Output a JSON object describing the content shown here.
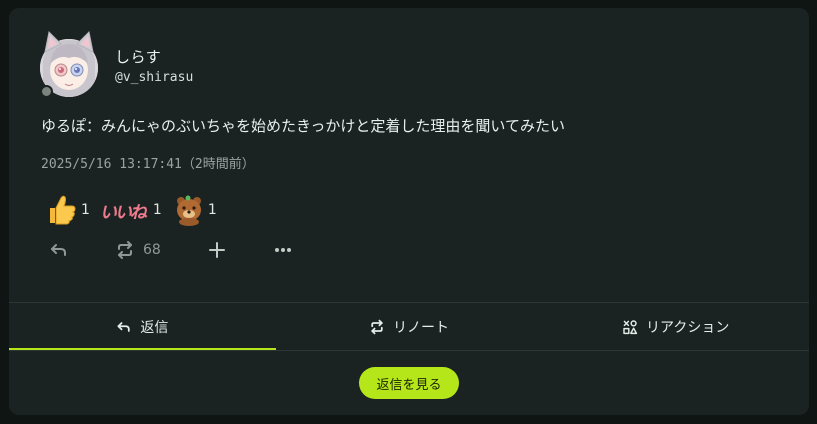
{
  "note": {
    "display_name": "しらす",
    "username": "@v_shirasu",
    "text": "ゆるぽ：みんにゃのぶいちゃを始めたきっかけと定着した理由を聞いてみたい",
    "timestamp": "2025/5/16 13:17:41（2時間前）"
  },
  "reactions": [
    {
      "icon": "thumbs-up-emoji",
      "count": "1"
    },
    {
      "icon": "iine-custom-emoji",
      "label": "いいね",
      "count": "1"
    },
    {
      "icon": "bear-custom-emoji",
      "count": "1"
    }
  ],
  "actions": {
    "reply_icon": "reply-icon",
    "renote_icon": "renote-icon",
    "renote_count": "68",
    "react_icon": "plus-icon",
    "more_icon": "more-icon"
  },
  "tabs": [
    {
      "icon": "reply-icon",
      "label": "返信",
      "active": true
    },
    {
      "icon": "renote-icon",
      "label": "リノート",
      "active": false
    },
    {
      "icon": "reaction-icon",
      "label": "リアクション",
      "active": false
    }
  ],
  "view_replies_label": "返信を見る",
  "colors": {
    "background": "#0f1513",
    "card": "#1a2321",
    "accent": "#b4e61a",
    "muted": "#8e9894"
  }
}
